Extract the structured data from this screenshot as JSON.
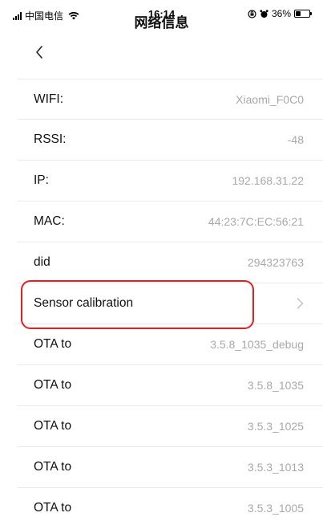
{
  "status_bar": {
    "carrier": "中国电信",
    "time": "16:14",
    "battery_percent": "36%",
    "battery_level": 0.36
  },
  "nav": {
    "title": "网络信息"
  },
  "rows": [
    {
      "label": "WIFI:",
      "value": "Xiaomi_F0C0"
    },
    {
      "label": "RSSI:",
      "value": "-48"
    },
    {
      "label": "IP:",
      "value": "192.168.31.22"
    },
    {
      "label": "MAC:",
      "value": "44:23:7C:EC:56:21"
    },
    {
      "label": "did",
      "value": "294323763"
    },
    {
      "label": "Sensor calibration",
      "value": ""
    },
    {
      "label": "OTA to",
      "value": "3.5.8_1035_debug"
    },
    {
      "label": "OTA to",
      "value": "3.5.8_1035"
    },
    {
      "label": "OTA to",
      "value": "3.5.3_1025"
    },
    {
      "label": "OTA to",
      "value": "3.5.3_1013"
    },
    {
      "label": "OTA to",
      "value": "3.5.3_1005"
    }
  ],
  "colors": {
    "highlight": "#e02020",
    "value_text": "#a8a8a8",
    "divider": "#e9e9e9"
  }
}
